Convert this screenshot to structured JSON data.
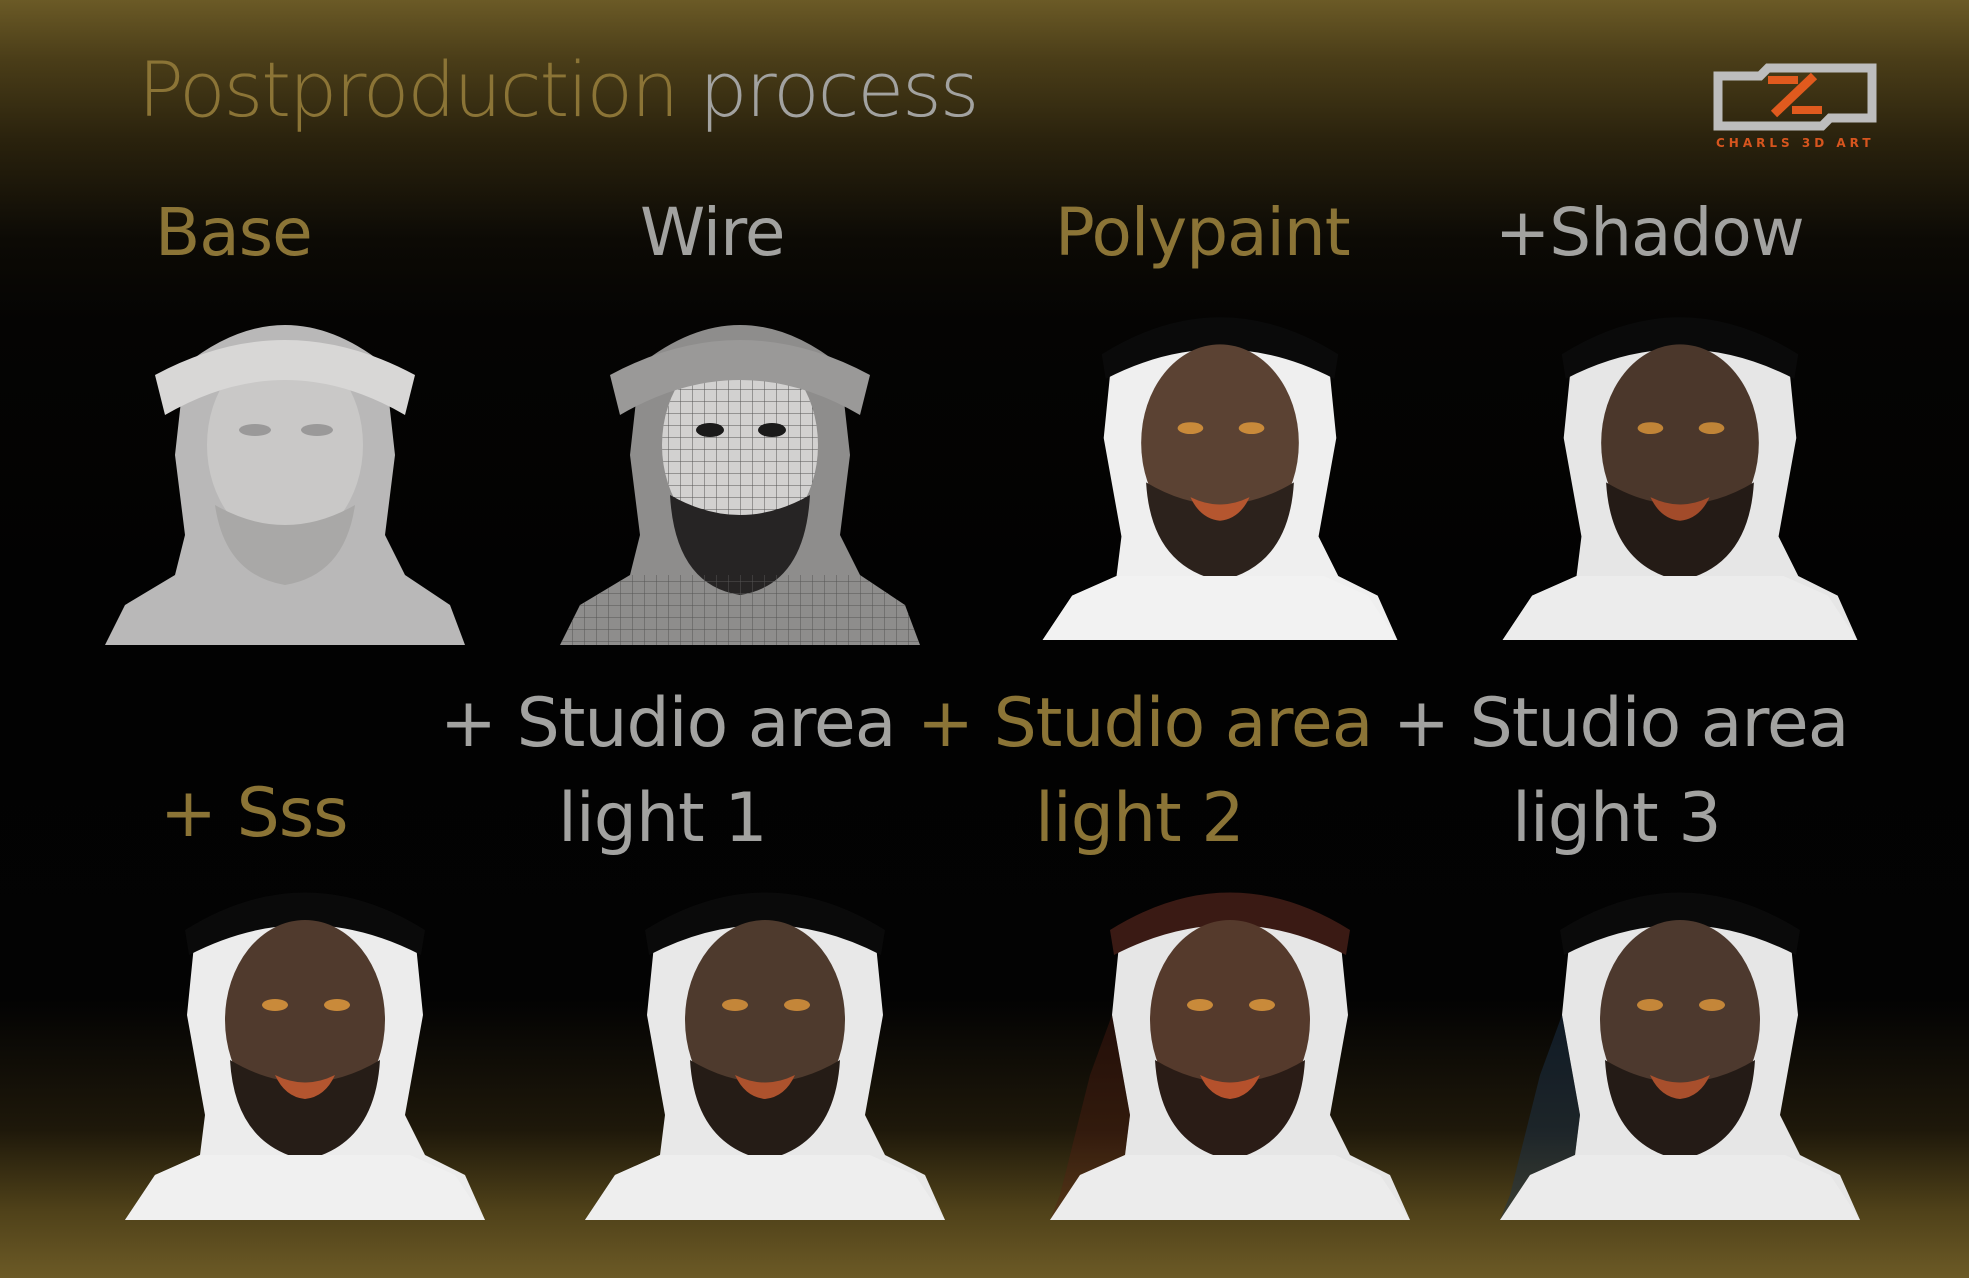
{
  "title": {
    "part1": "Postproduction",
    "part2": "process"
  },
  "logo": {
    "text": "CHARLS 3D ART",
    "accent_color": "#e05a1e"
  },
  "colors": {
    "gold": "#8b7436",
    "silver": "#a2a2a0"
  },
  "stages": [
    {
      "label": "Base"
    },
    {
      "label": "Wire"
    },
    {
      "label": "Polypaint"
    },
    {
      "label": "+Shadow"
    },
    {
      "label": "+ Sss"
    },
    {
      "label_line1": "+ Studio area",
      "label_line2": "light 1"
    },
    {
      "label_line1": "+ Studio area",
      "label_line2": "light 2"
    },
    {
      "label_line1": "+ Studio area",
      "label_line2": "light 3"
    }
  ]
}
